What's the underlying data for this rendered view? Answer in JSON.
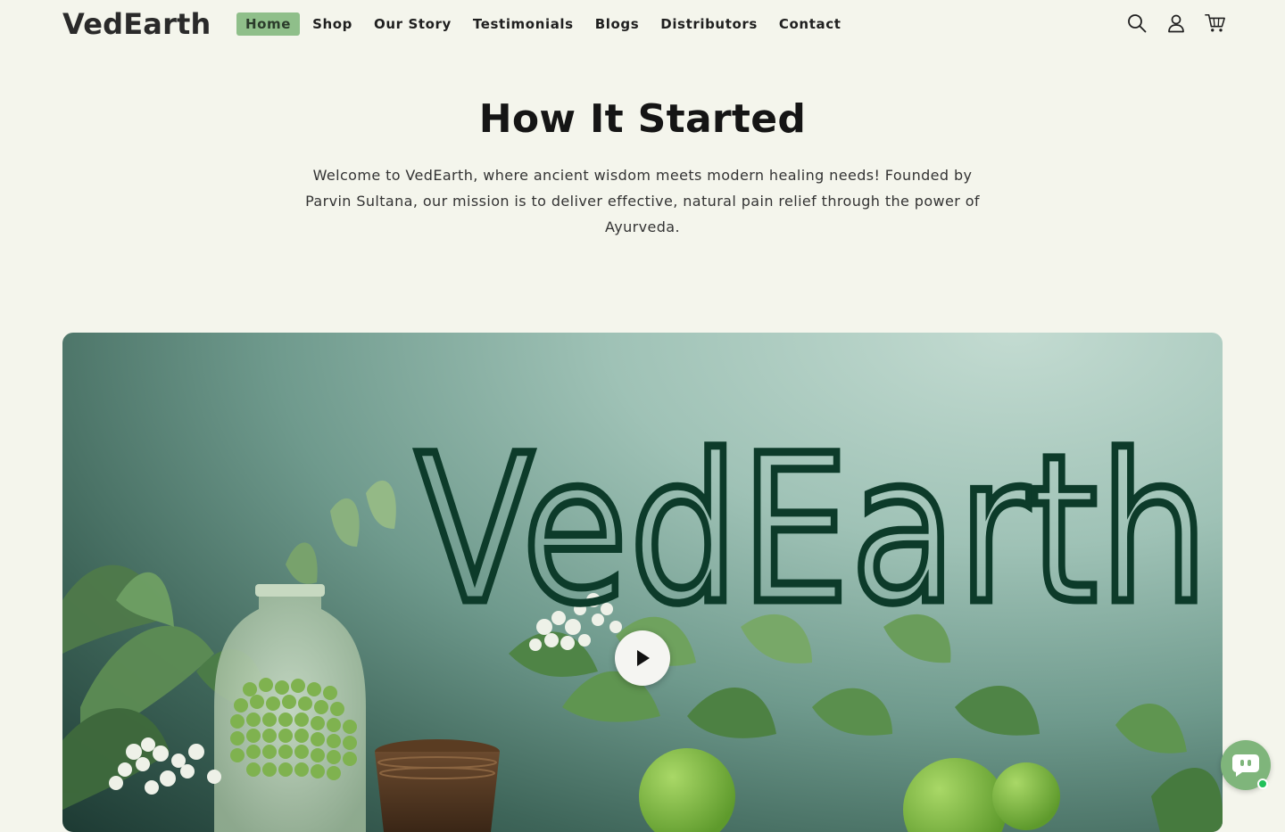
{
  "brand": {
    "name": "VedEarth"
  },
  "nav": {
    "items": [
      {
        "label": "Home",
        "active": true
      },
      {
        "label": "Shop"
      },
      {
        "label": "Our Story"
      },
      {
        "label": "Testimonials"
      },
      {
        "label": "Blogs"
      },
      {
        "label": "Distributors"
      },
      {
        "label": "Contact"
      }
    ]
  },
  "header_icons": [
    "search-icon",
    "account-icon",
    "cart-icon"
  ],
  "intro": {
    "title": "How It Started",
    "body": "Welcome to VedEarth, where ancient wisdom meets modern healing needs! Founded by Parvin Sultana, our mission is to deliver effective, natural pain relief through the power of Ayurveda."
  },
  "video": {
    "overlay_text": "VedEarth",
    "play_icon": "play-icon"
  },
  "chat": {
    "icon": "chat-icon",
    "status": "online"
  },
  "colors": {
    "page_bg": "#f4f5ec",
    "nav_active_bg": "#8fbf8a",
    "video_text": "#0d3b2a",
    "chat_bg": "#7fb57b",
    "online_dot": "#21c15a"
  }
}
